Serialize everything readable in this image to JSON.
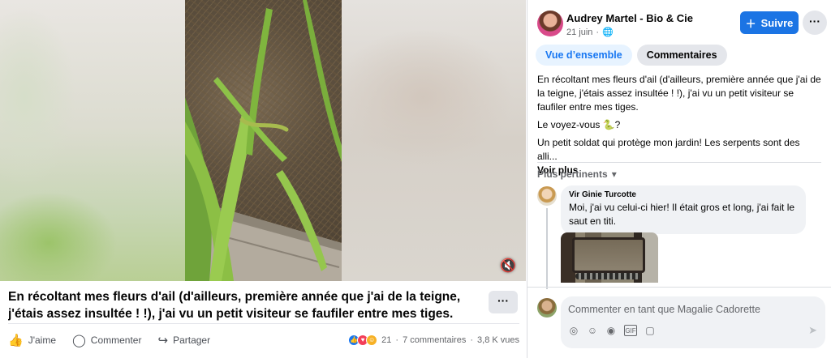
{
  "post": {
    "caption": "En récoltant mes fleurs d'ail (d'ailleurs, première année que j'ai de la teigne, j'étais assez insultée ! !), j'ai vu un petit visiteur se faufiler entre mes tiges. Le...",
    "more_label": "···",
    "actions": {
      "like": "J'aime",
      "comment": "Commenter",
      "share": "Partager"
    },
    "stats": {
      "reactions": "21",
      "comments": "7 commentaires",
      "views": "3,8 K vues",
      "separator": "·"
    }
  },
  "panel": {
    "author": "Audrey Martel - Bio & Cie",
    "date": "21 juin",
    "dot": "·",
    "follow_label": "Suivre",
    "more_label": "···",
    "tabs": [
      {
        "label": "Vue d’ensemble"
      },
      {
        "label": "Commentaires"
      }
    ],
    "text": {
      "p1": "En récoltant mes fleurs d'ail (d'ailleurs, première année que j'ai de la teigne, j'étais assez insultée ! !), j'ai vu un petit visiteur se faufiler entre mes tiges.",
      "p2": "Le voyez-vous",
      "p2_end": "?",
      "p3": "Un petit soldat qui protège mon jardin! Les serpents sont des alli...",
      "see_more": "Voir plus"
    },
    "sort_label": "Plus pertinents",
    "comment": {
      "author": "Vir Ginie Turcotte",
      "text": "Moi, j'ai vu celui-ci hier! Il était gros et long, j'ai fait le saut en titi."
    },
    "composer": {
      "placeholder": "Commenter en tant que Magalie Cadorette"
    }
  },
  "colors": {
    "accent": "#1b74e4",
    "tab_active_bg": "#e7f3ff",
    "tab_active_text": "#1877f2",
    "bubble": "#f0f2f5"
  },
  "icons": [
    "mute-icon",
    "like-icon",
    "comment-icon",
    "share-icon",
    "globe-icon",
    "follow-plus-icon",
    "chevron-down-icon",
    "avatar-icon",
    "gif-icon",
    "sticker-icon",
    "emoji-icon",
    "camera-icon",
    "send-icon",
    "snake-icon"
  ]
}
